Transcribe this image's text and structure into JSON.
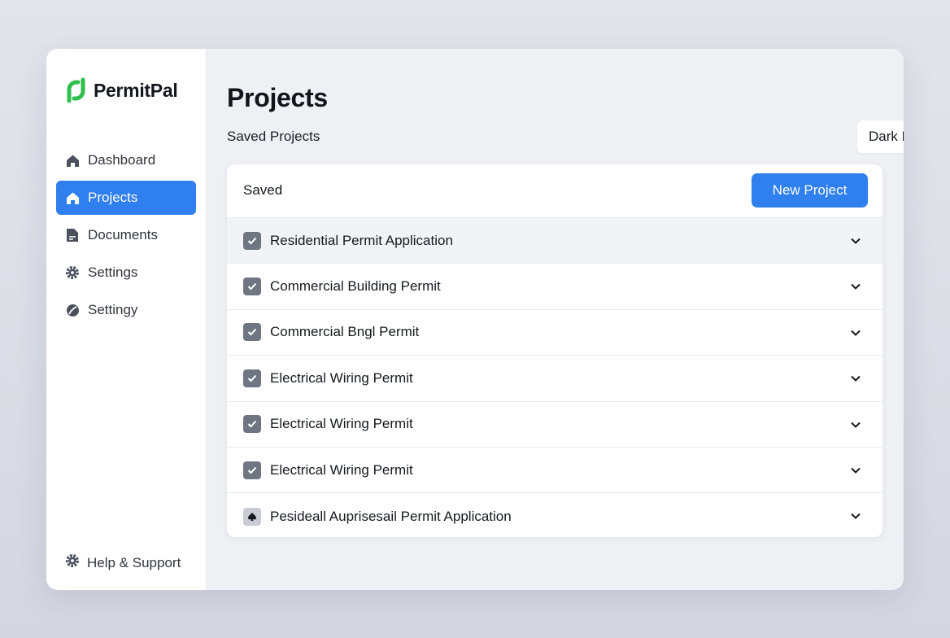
{
  "app": {
    "name": "PermitPal"
  },
  "sidebar": {
    "items": [
      {
        "label": "Dashboard",
        "icon": "home-icon",
        "active": false
      },
      {
        "label": "Projects",
        "icon": "home-icon",
        "active": true
      },
      {
        "label": "Documents",
        "icon": "document-icon",
        "active": false
      },
      {
        "label": "Settings",
        "icon": "gear-icon",
        "active": false
      },
      {
        "label": "Settingy",
        "icon": "leaf-icon",
        "active": false
      }
    ],
    "help_label": "Help & Support"
  },
  "header": {
    "title": "Projects",
    "subtitle": "Saved Projects",
    "mode_select": "Dark Mode/Light Mode"
  },
  "card": {
    "title": "Saved",
    "new_button": "New Project",
    "rows": [
      {
        "label": "Residential Permit Application",
        "checked": true
      },
      {
        "label": "Commercial Building Permit",
        "checked": true
      },
      {
        "label": "Commercial Bngl Permit",
        "checked": true
      },
      {
        "label": "Electrical Wiring Permit",
        "checked": true
      },
      {
        "label": "Electrical Wiring Permit",
        "checked": true
      },
      {
        "label": "Electrical Wiring Permit",
        "checked": true
      },
      {
        "label": "Pesideall Auprisesail Permit Application",
        "checked": false
      }
    ]
  },
  "colors": {
    "accent": "#2f7fef",
    "brand": "#2fbf4f",
    "badge": "#f2682b"
  }
}
